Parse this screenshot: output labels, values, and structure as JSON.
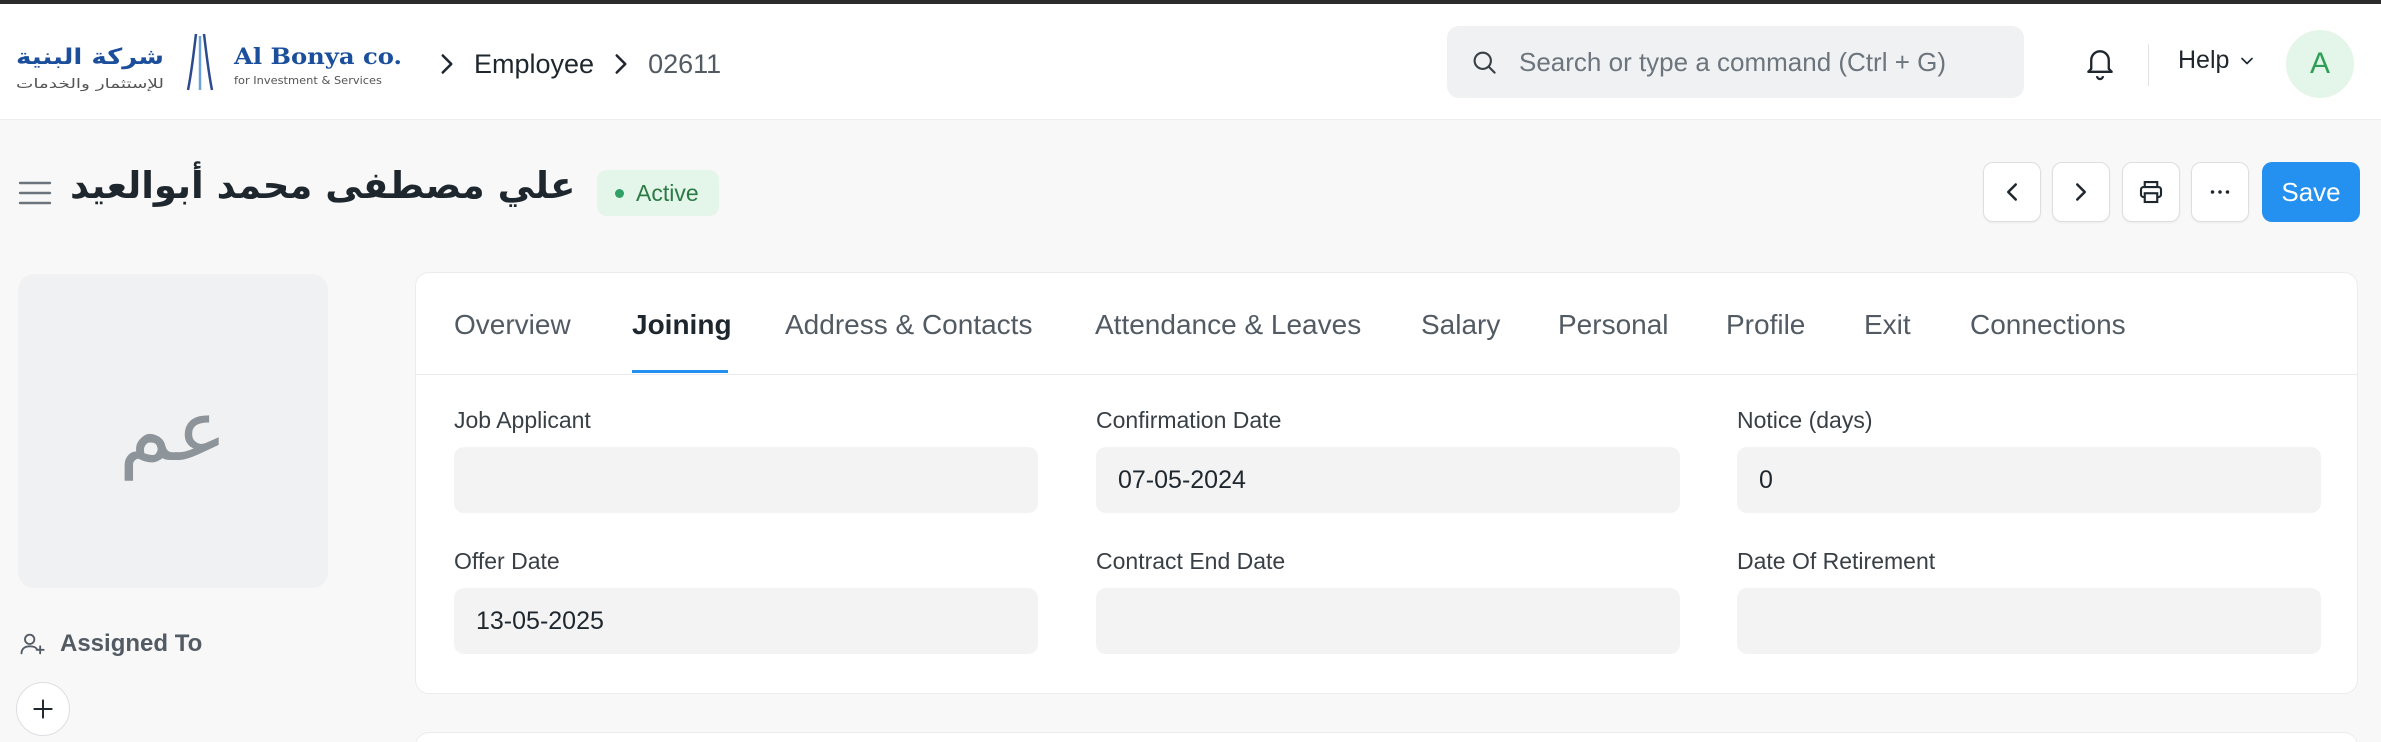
{
  "brand": {
    "arabic_name": "شركة البنية",
    "arabic_tagline": "للإستثمار والخدمات",
    "english_name": "Al Bonya co.",
    "english_tagline": "for Investment & Services"
  },
  "breadcrumb": {
    "doctype": "Employee",
    "current": "02611"
  },
  "search": {
    "placeholder": "Search or type a command (Ctrl + G)"
  },
  "nav": {
    "help_label": "Help",
    "avatar_initial": "A"
  },
  "header": {
    "title": "علي مصطفى محمد أبوالعيد",
    "status": "Active",
    "save_label": "Save"
  },
  "sidebar": {
    "avatar_initials": "عم",
    "assigned_label": "Assigned To"
  },
  "tabs": [
    {
      "label": "Overview"
    },
    {
      "label": "Joining"
    },
    {
      "label": "Address & Contacts"
    },
    {
      "label": "Attendance & Leaves"
    },
    {
      "label": "Salary"
    },
    {
      "label": "Personal"
    },
    {
      "label": "Profile"
    },
    {
      "label": "Exit"
    },
    {
      "label": "Connections"
    }
  ],
  "fields": {
    "job_applicant": {
      "label": "Job Applicant",
      "value": ""
    },
    "confirmation_date": {
      "label": "Confirmation Date",
      "value": "07-05-2024"
    },
    "notice_days": {
      "label": "Notice (days)",
      "value": "0"
    },
    "offer_date": {
      "label": "Offer Date",
      "value": "13-05-2025"
    },
    "contract_end_date": {
      "label": "Contract End Date",
      "value": ""
    },
    "date_of_retirement": {
      "label": "Date Of Retirement",
      "value": ""
    }
  },
  "colors": {
    "primary": "#2490ef",
    "status_bg": "#e4f5e9",
    "status_text": "#2c7a46",
    "logo_blue": "#1b4f9c"
  },
  "icons": [
    "chevron-right-icon",
    "search-icon",
    "bell-icon",
    "chevron-down-icon",
    "hamburger-icon",
    "chevron-left-icon",
    "printer-icon",
    "more-icon",
    "user-plus-icon",
    "plus-icon"
  ]
}
